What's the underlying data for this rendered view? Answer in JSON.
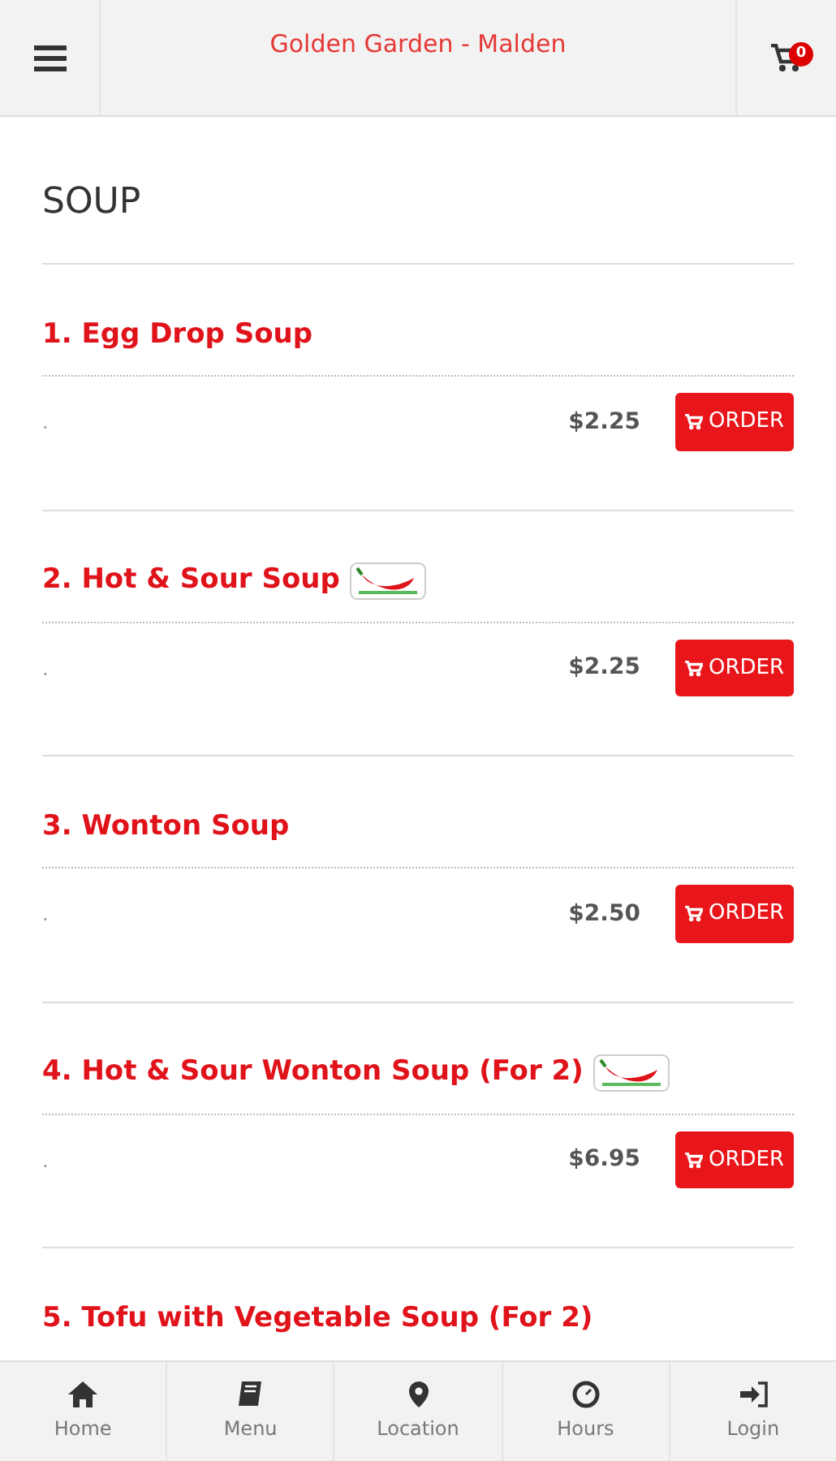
{
  "header": {
    "title": "Golden Garden - Malden",
    "cart_count": "0"
  },
  "section": {
    "title": "SOUP"
  },
  "items": [
    {
      "name": "1. Egg Drop Soup",
      "spicy": false,
      "description": ".",
      "price": "$2.25",
      "button": "ORDER"
    },
    {
      "name": "2. Hot & Sour Soup",
      "spicy": true,
      "description": ".",
      "price": "$2.25",
      "button": "ORDER"
    },
    {
      "name": "3. Wonton Soup",
      "spicy": false,
      "description": ".",
      "price": "$2.50",
      "button": "ORDER"
    },
    {
      "name": "4. Hot & Sour Wonton Soup (For 2)",
      "spicy": true,
      "description": ".",
      "price": "$6.95",
      "button": "ORDER"
    },
    {
      "name": "5. Tofu with Vegetable Soup (For 2)",
      "spicy": false
    }
  ],
  "tabbar": [
    {
      "kind": "home",
      "label": "Home"
    },
    {
      "kind": "menu",
      "label": "Menu"
    },
    {
      "kind": "location",
      "label": "Location"
    },
    {
      "kind": "hours",
      "label": "Hours"
    },
    {
      "kind": "login",
      "label": "Login"
    }
  ]
}
